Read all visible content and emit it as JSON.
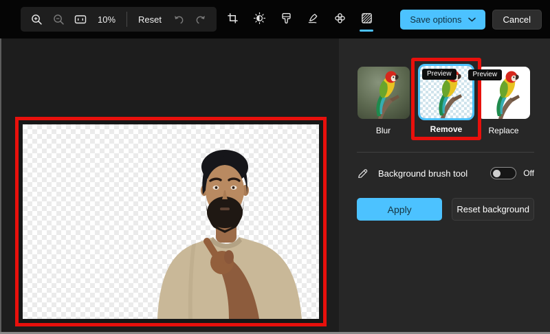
{
  "toolbar": {
    "zoom_level": "10%",
    "reset_label": "Reset",
    "save_options_label": "Save options",
    "cancel_label": "Cancel"
  },
  "panel": {
    "options": [
      {
        "label": "Blur"
      },
      {
        "label": "Remove",
        "badge": "Preview",
        "selected": true
      },
      {
        "label": "Replace",
        "badge": "Preview"
      }
    ],
    "brush_label": "Background brush tool",
    "brush_state": "Off",
    "apply_label": "Apply",
    "reset_background_label": "Reset background"
  },
  "colors": {
    "accent": "#4cc2ff",
    "annotation": "#e8100c",
    "apply_button": "#4cc2ff"
  }
}
